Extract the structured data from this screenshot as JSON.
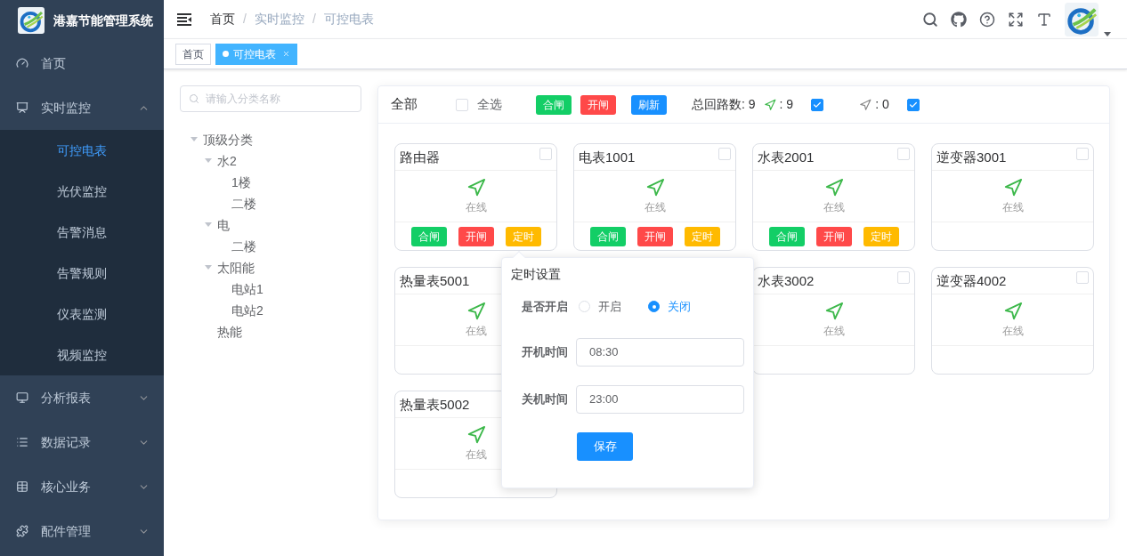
{
  "app": {
    "title": "港嘉节能管理系统"
  },
  "sidebar": {
    "items": [
      {
        "label": "首页"
      },
      {
        "label": "实时监控",
        "expanded": true,
        "children": [
          {
            "label": "可控电表",
            "selected": true
          },
          {
            "label": "光伏监控",
            "selected": false
          },
          {
            "label": "告警消息",
            "selected": false
          },
          {
            "label": "告警规则",
            "selected": false
          },
          {
            "label": "仪表监测",
            "selected": false
          },
          {
            "label": "视频监控",
            "selected": false
          }
        ]
      },
      {
        "label": "分析报表",
        "expanded": false
      },
      {
        "label": "数据记录",
        "expanded": false
      },
      {
        "label": "核心业务",
        "expanded": false
      },
      {
        "label": "配件管理",
        "expanded": false
      }
    ]
  },
  "breadcrumb": {
    "separator": "/",
    "items": [
      "首页",
      "实时监控",
      "可控电表"
    ]
  },
  "tags": [
    {
      "label": "首页",
      "selected": false
    },
    {
      "label": "可控电表",
      "selected": true
    }
  ],
  "tree": {
    "placeholder": "请输入分类名称",
    "nodes": [
      {
        "label": "顶级分类",
        "expanded": true,
        "children": [
          {
            "label": "水2",
            "expanded": true,
            "children": [
              {
                "label": "1楼"
              },
              {
                "label": "二楼"
              }
            ]
          },
          {
            "label": "电",
            "expanded": true,
            "children": [
              {
                "label": "二楼"
              }
            ]
          },
          {
            "label": "太阳能",
            "expanded": true,
            "children": [
              {
                "label": "电站1"
              },
              {
                "label": "电站2"
              }
            ]
          },
          {
            "label": "热能"
          }
        ]
      }
    ]
  },
  "panel": {
    "title": "全部",
    "select_all": {
      "label": "全选",
      "checked": false
    },
    "buttons": [
      {
        "label": "合闸",
        "kind": "close"
      },
      {
        "label": "开闸",
        "kind": "open"
      },
      {
        "label": "刷新",
        "kind": "refresh"
      }
    ],
    "total": "总回路数: 9",
    "filters": [
      {
        "online": true,
        "count": ": 9",
        "checked": true
      },
      {
        "online": false,
        "count": ": 0",
        "checked": true
      }
    ]
  },
  "devices": [
    {
      "name": "路由器",
      "checked": false,
      "online": true,
      "status": "在线",
      "buttons": [
        {
          "label": "合闸",
          "kind": "close"
        },
        {
          "label": "开闸",
          "kind": "open"
        },
        {
          "label": "定时",
          "kind": "timer"
        }
      ]
    },
    {
      "name": "电表1001",
      "checked": false,
      "online": true,
      "status": "在线",
      "buttons": [
        {
          "label": "合闸",
          "kind": "close"
        },
        {
          "label": "开闸",
          "kind": "open"
        },
        {
          "label": "定时",
          "kind": "timer"
        }
      ]
    },
    {
      "name": "水表2001",
      "checked": false,
      "online": true,
      "status": "在线",
      "buttons": [
        {
          "label": "合闸",
          "kind": "close"
        },
        {
          "label": "开闸",
          "kind": "open"
        },
        {
          "label": "定时",
          "kind": "timer"
        }
      ]
    },
    {
      "name": "逆变器3001",
      "checked": false,
      "online": true,
      "status": "在线"
    },
    {
      "name": "热量表5001",
      "online": true,
      "status": "在线"
    },
    {
      "name": "水表3002",
      "checked": false,
      "online": true,
      "status": "在线"
    },
    {
      "name": "逆变器4002",
      "checked": false,
      "online": true,
      "status": "在线"
    },
    {
      "name": "热量表5002",
      "online": true,
      "status": "在线"
    }
  ],
  "timer_popover": {
    "title": "定时设置",
    "enable_label": "是否开启",
    "options": [
      {
        "label": "开启",
        "selected": false
      },
      {
        "label": "关闭",
        "selected": true
      }
    ],
    "fields": [
      {
        "label": "开机时间",
        "value": "08:30"
      },
      {
        "label": "关机时间",
        "value": "23:00"
      }
    ],
    "save": "保存"
  }
}
